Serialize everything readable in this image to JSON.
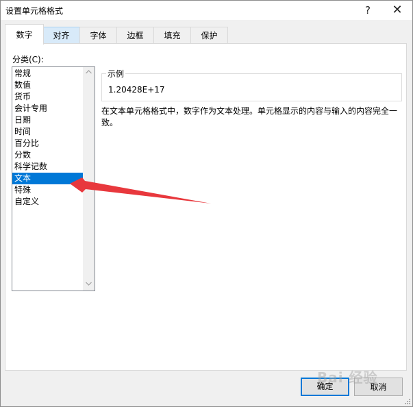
{
  "window": {
    "title": "设置单元格格式",
    "help_label": "?",
    "close_label": "✕"
  },
  "tabs": [
    {
      "label": "数字",
      "state": "active"
    },
    {
      "label": "对齐",
      "state": "hover"
    },
    {
      "label": "字体",
      "state": "normal"
    },
    {
      "label": "边框",
      "state": "normal"
    },
    {
      "label": "填充",
      "state": "normal"
    },
    {
      "label": "保护",
      "state": "normal"
    }
  ],
  "category": {
    "label": "分类(C):",
    "items": [
      {
        "label": "常规",
        "selected": false
      },
      {
        "label": "数值",
        "selected": false
      },
      {
        "label": "货币",
        "selected": false
      },
      {
        "label": "会计专用",
        "selected": false
      },
      {
        "label": "日期",
        "selected": false
      },
      {
        "label": "时间",
        "selected": false
      },
      {
        "label": "百分比",
        "selected": false
      },
      {
        "label": "分数",
        "selected": false
      },
      {
        "label": "科学记数",
        "selected": false
      },
      {
        "label": "文本",
        "selected": true
      },
      {
        "label": "特殊",
        "selected": false
      },
      {
        "label": "自定义",
        "selected": false
      }
    ],
    "scroll_up_icon": "chevron-up-icon",
    "scroll_down_icon": "chevron-down-icon"
  },
  "sample": {
    "legend": "示例",
    "value": "1.20428E+17"
  },
  "description": "在文本单元格格式中，数字作为文本处理。单元格显示的内容与输入的内容完全一致。",
  "buttons": {
    "ok_label": "确定",
    "cancel_label": "取消"
  },
  "watermark": "Bai 经验",
  "colors": {
    "selection": "#0078d7",
    "annotation_arrow": "#e8383d",
    "tab_hover": "#d8eaf9"
  }
}
